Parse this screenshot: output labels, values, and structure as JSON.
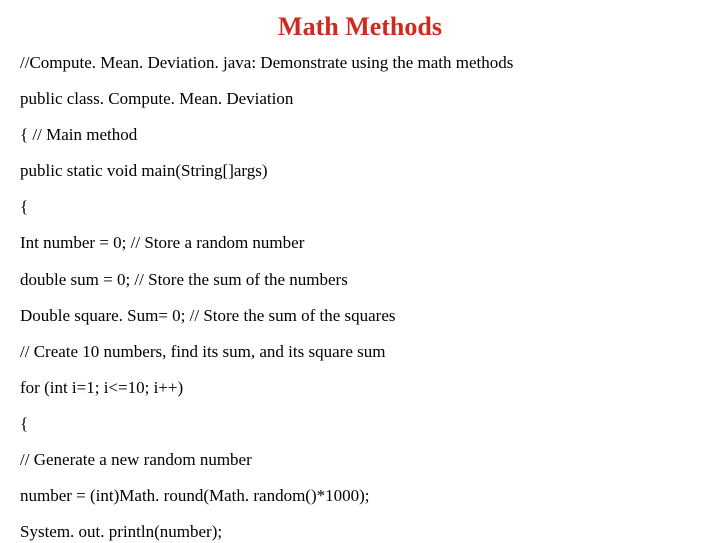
{
  "title": "Math Methods",
  "lines": [
    "//Compute. Mean. Deviation. java: Demonstrate using the math methods",
    "public class. Compute. Mean. Deviation",
    "{   // Main method",
    "public static void main(String[]args)",
    "{",
    "Int number = 0; // Store a random number",
    "double sum = 0; // Store the sum of the numbers",
    "Double square. Sum= 0; // Store the sum of the squares",
    "// Create 10 numbers, find its sum, and its square sum",
    "for (int i=1; i<=10; i++)",
    "{",
    "// Generate a new random number",
    "number = (int)Math. round(Math. random()*1000);",
    "System. out. println(number);"
  ]
}
